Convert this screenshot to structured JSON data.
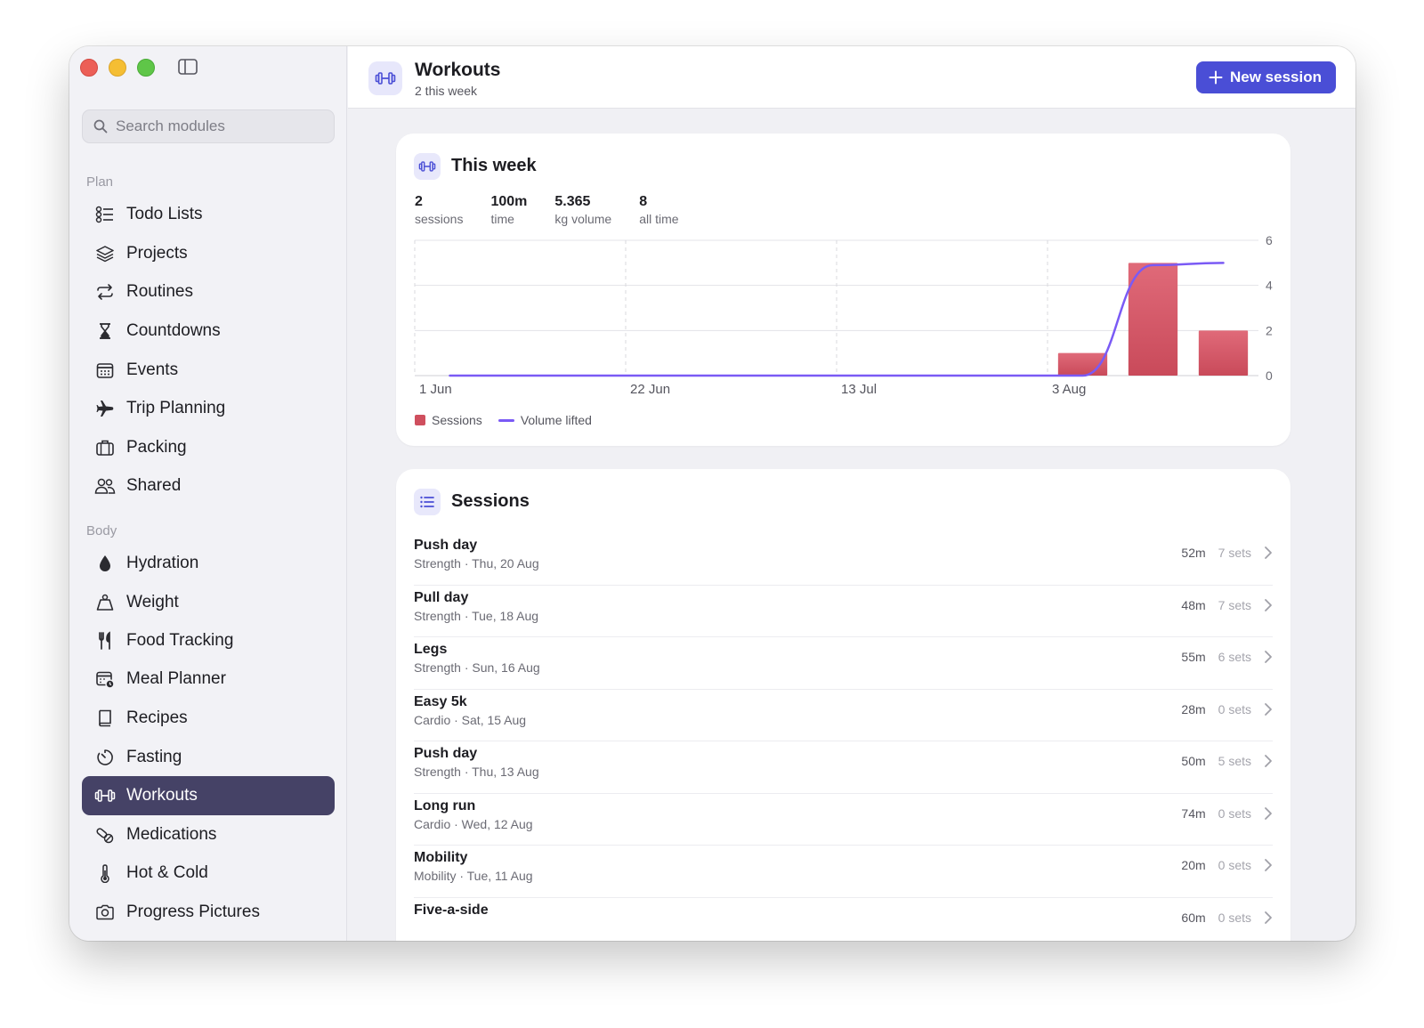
{
  "search": {
    "placeholder": "Search modules"
  },
  "sidebar": {
    "sections": [
      {
        "label": "Plan",
        "items": [
          {
            "label": "Todo Lists",
            "icon": "checklist-icon"
          },
          {
            "label": "Projects",
            "icon": "layers-icon"
          },
          {
            "label": "Routines",
            "icon": "repeat-icon"
          },
          {
            "label": "Countdowns",
            "icon": "hourglass-icon"
          },
          {
            "label": "Events",
            "icon": "calendar-icon"
          },
          {
            "label": "Trip Planning",
            "icon": "airplane-icon"
          },
          {
            "label": "Packing",
            "icon": "suitcase-icon"
          },
          {
            "label": "Shared",
            "icon": "people-icon"
          }
        ]
      },
      {
        "label": "Body",
        "items": [
          {
            "label": "Hydration",
            "icon": "drop-icon"
          },
          {
            "label": "Weight",
            "icon": "weight-icon"
          },
          {
            "label": "Food Tracking",
            "icon": "fork-knife-icon"
          },
          {
            "label": "Meal Planner",
            "icon": "calendar-clock-icon"
          },
          {
            "label": "Recipes",
            "icon": "book-icon"
          },
          {
            "label": "Fasting",
            "icon": "timer-icon"
          },
          {
            "label": "Workouts",
            "icon": "dumbbell-icon",
            "active": true
          },
          {
            "label": "Medications",
            "icon": "pills-icon"
          },
          {
            "label": "Hot & Cold",
            "icon": "thermometer-icon"
          },
          {
            "label": "Progress Pictures",
            "icon": "camera-icon"
          }
        ]
      }
    ]
  },
  "header": {
    "title": "Workouts",
    "subtitle": "2 this week",
    "new_button_label": "New session"
  },
  "week": {
    "title": "This week",
    "stats": [
      {
        "value": "2",
        "label": "sessions"
      },
      {
        "value": "100m",
        "label": "time"
      },
      {
        "value": "5.365",
        "label": "kg volume"
      },
      {
        "value": "8",
        "label": "all time"
      }
    ]
  },
  "chart_data": {
    "type": "bar",
    "x_ticks": [
      "1 Jun",
      "22 Jun",
      "13 Jul",
      "3 Aug"
    ],
    "y_ticks": [
      0,
      2,
      4,
      6
    ],
    "ylim": [
      0,
      6
    ],
    "grid": true,
    "legend_position": "bottom-left",
    "colors": {
      "sessions": "#cf4f5e",
      "volume": "#7a5af5"
    },
    "series": [
      {
        "name": "Sessions",
        "type": "bar",
        "x": [
          "3 Aug",
          "10 Aug",
          "17 Aug"
        ],
        "values": [
          1,
          5,
          2
        ]
      },
      {
        "name": "Volume lifted",
        "type": "line",
        "x": [
          "1 Jun",
          "8 Jun",
          "15 Jun",
          "22 Jun",
          "29 Jun",
          "6 Jul",
          "13 Jul",
          "20 Jul",
          "27 Jul",
          "3 Aug",
          "10 Aug",
          "17 Aug"
        ],
        "values": [
          0,
          0,
          0,
          0,
          0,
          0,
          0,
          0,
          0,
          0,
          4.9,
          5.0
        ]
      }
    ]
  },
  "sessions": {
    "title": "Sessions",
    "rows": [
      {
        "title": "Push day",
        "sub": "Strength · Thu, 20 Aug",
        "duration": "52m",
        "sets": "7 sets"
      },
      {
        "title": "Pull day",
        "sub": "Strength · Tue, 18 Aug",
        "duration": "48m",
        "sets": "7 sets"
      },
      {
        "title": "Legs",
        "sub": "Strength · Sun, 16 Aug",
        "duration": "55m",
        "sets": "6 sets"
      },
      {
        "title": "Easy 5k",
        "sub": "Cardio · Sat, 15 Aug",
        "duration": "28m",
        "sets": "0 sets"
      },
      {
        "title": "Push day",
        "sub": "Strength · Thu, 13 Aug",
        "duration": "50m",
        "sets": "5 sets"
      },
      {
        "title": "Long run",
        "sub": "Cardio · Wed, 12 Aug",
        "duration": "74m",
        "sets": "0 sets"
      },
      {
        "title": "Mobility",
        "sub": "Mobility · Tue, 11 Aug",
        "duration": "20m",
        "sets": "0 sets"
      },
      {
        "title": "Five-a-side",
        "sub": "",
        "duration": "60m",
        "sets": "0 sets"
      }
    ]
  }
}
